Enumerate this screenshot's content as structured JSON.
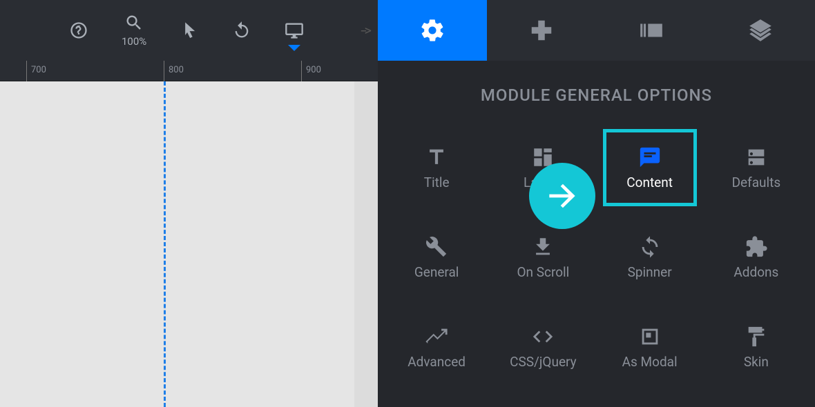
{
  "toolbar": {
    "zoom_value": "100%",
    "arrow_hint": "-->"
  },
  "ruler": {
    "marks": [
      "700",
      "800",
      "900"
    ]
  },
  "sidebar": {
    "title": "MODULE GENERAL OPTIONS",
    "options": [
      {
        "label": "Title"
      },
      {
        "label": "Layout"
      },
      {
        "label": "Content"
      },
      {
        "label": "Defaults"
      },
      {
        "label": "General"
      },
      {
        "label": "On Scroll"
      },
      {
        "label": "Spinner"
      },
      {
        "label": "Addons"
      },
      {
        "label": "Advanced"
      },
      {
        "label": "CSS/jQuery"
      },
      {
        "label": "As Modal"
      },
      {
        "label": "Skin"
      }
    ],
    "selected_index": 2
  },
  "colors": {
    "accent_blue": "#007aff",
    "highlight_cyan": "#14c7d6",
    "guide_blue": "#1f7fe8"
  }
}
